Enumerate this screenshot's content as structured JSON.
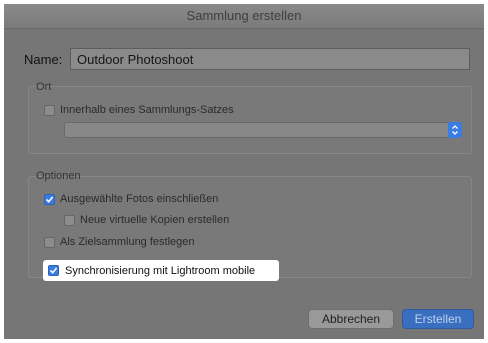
{
  "dialog": {
    "title": "Sammlung erstellen",
    "name_label": "Name:",
    "name_value": "Outdoor Photoshoot",
    "location": {
      "title": "Ort",
      "inside_set_label": "Innerhalb eines Sammlungs-Satzes",
      "inside_set_checked": false,
      "set_select_value": ""
    },
    "options": {
      "title": "Optionen",
      "include_selected_label": "Ausgewählte Fotos einschließen",
      "include_selected_checked": true,
      "virtual_copies_label": "Neue virtuelle Kopien erstellen",
      "virtual_copies_checked": false,
      "target_collection_label": "Als Zielsammlung festlegen",
      "target_collection_checked": false,
      "sync_label": "Synchronisierung mit Lightroom mobile",
      "sync_checked": true
    },
    "buttons": {
      "cancel": "Abbrechen",
      "create": "Erstellen"
    }
  },
  "colors": {
    "accent": "#3a7de0",
    "dialog_bg": "#767676",
    "highlight_bg": "#ffffff"
  }
}
